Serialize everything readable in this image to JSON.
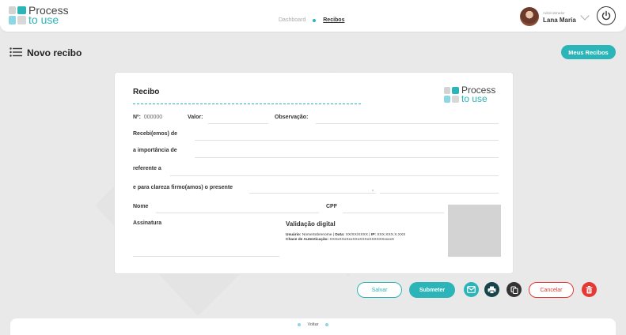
{
  "header": {
    "logo_line1": "Process",
    "logo_line2": "to use",
    "nav": [
      "Dashboard",
      "Recibos"
    ],
    "user_role": "Administrador",
    "user_name": "Lana Maria"
  },
  "page": {
    "title": "Novo recibo",
    "meus_recibos_label": "Meus Recibos"
  },
  "receipt": {
    "title": "Recibo",
    "logo_line1": "Process",
    "logo_line2": "to use",
    "number_label": "Nº:",
    "number_value": "000000",
    "valor_label": "Valor:",
    "observacao_label": "Observação:",
    "recebi_label": "Recebi(emos) de",
    "importancia_label": "a importância de",
    "referente_label": "referente a",
    "clareza_label": "e para clareza firmo(amos) o presente",
    "comma": ",",
    "nome_label": "Nome",
    "cpf_label": "CPF",
    "assinatura_label": "Assinatura",
    "validacao_label": "Validação digital",
    "usuario_label": "Usuário:",
    "usuario_value": "NomeSobrenome",
    "data_label": "Data:",
    "data_value": "XX/XX/XXXX",
    "ip_label": "IP:",
    "ip_value": "XXX.XXX.X.XXX",
    "chave_label": "Chave de Autenticação:",
    "chave_value": "XXXxXXxXxxXXxXXXxXXXXXXxxxxX"
  },
  "actions": {
    "salvar": "Salvar",
    "submeter": "Submeter",
    "cancelar": "Cancelar"
  },
  "footer": {
    "voltar": "Voltar"
  },
  "colors": {
    "accent": "#2bb5b8",
    "danger": "#e53935",
    "dark": "#17434b"
  }
}
